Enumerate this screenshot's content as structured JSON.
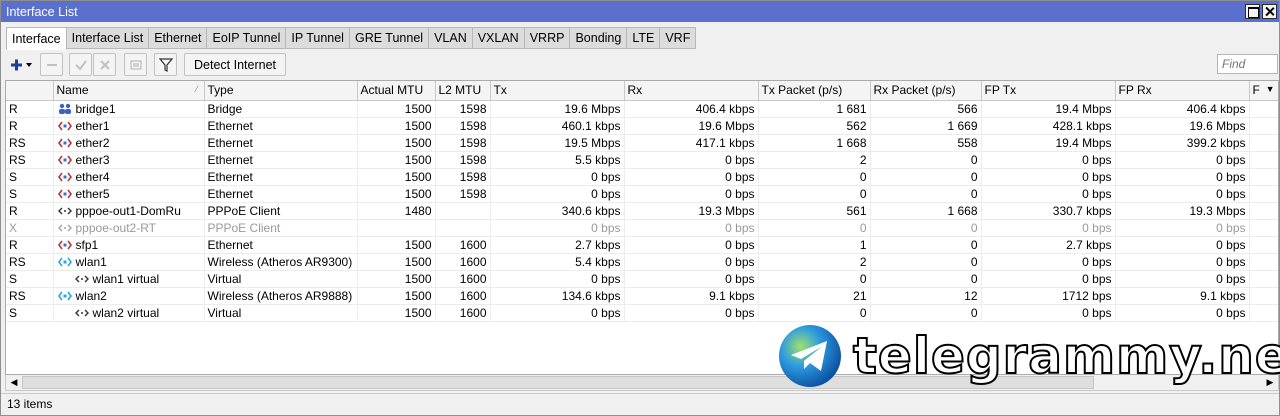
{
  "window": {
    "title": "Interface List"
  },
  "tabs": [
    {
      "label": "Interface",
      "active": true
    },
    {
      "label": "Interface List"
    },
    {
      "label": "Ethernet"
    },
    {
      "label": "EoIP Tunnel"
    },
    {
      "label": "IP Tunnel"
    },
    {
      "label": "GRE Tunnel"
    },
    {
      "label": "VLAN"
    },
    {
      "label": "VXLAN"
    },
    {
      "label": "VRRP"
    },
    {
      "label": "Bonding"
    },
    {
      "label": "LTE"
    },
    {
      "label": "VRF"
    }
  ],
  "toolbar": {
    "add_icon": "plus-icon",
    "remove_icon": "minus-icon",
    "enable_icon": "check-icon",
    "disable_icon": "cross-icon",
    "comment_icon": "comment-icon",
    "filter_icon": "filter-icon",
    "detect_label": "Detect Internet",
    "find_placeholder": "Find"
  },
  "table": {
    "columns": [
      "",
      "Name",
      "Type",
      "Actual MTU",
      "L2 MTU",
      "Tx",
      "Rx",
      "Tx Packet (p/s)",
      "Rx Packet (p/s)",
      "FP Tx",
      "FP Rx",
      "F"
    ],
    "rows": [
      {
        "flags": "R",
        "icon": "bridge-icon",
        "name": "bridge1",
        "indent": false,
        "type": "Bridge",
        "mtu": "1500",
        "l2mtu": "1598",
        "tx": "19.6 Mbps",
        "rx": "406.4 kbps",
        "txp": "1 681",
        "rxp": "566",
        "fptx": "19.4 Mbps",
        "fprx": "406.4 kbps",
        "disabled": false
      },
      {
        "flags": "R",
        "icon": "ethernet-icon",
        "name": "ether1",
        "indent": false,
        "type": "Ethernet",
        "mtu": "1500",
        "l2mtu": "1598",
        "tx": "460.1 kbps",
        "rx": "19.6 Mbps",
        "txp": "562",
        "rxp": "1 669",
        "fptx": "428.1 kbps",
        "fprx": "19.6 Mbps",
        "disabled": false
      },
      {
        "flags": "RS",
        "icon": "ethernet-icon",
        "name": "ether2",
        "indent": false,
        "type": "Ethernet",
        "mtu": "1500",
        "l2mtu": "1598",
        "tx": "19.5 Mbps",
        "rx": "417.1 kbps",
        "txp": "1 668",
        "rxp": "558",
        "fptx": "19.4 Mbps",
        "fprx": "399.2 kbps",
        "disabled": false
      },
      {
        "flags": "RS",
        "icon": "ethernet-icon",
        "name": "ether3",
        "indent": false,
        "type": "Ethernet",
        "mtu": "1500",
        "l2mtu": "1598",
        "tx": "5.5 kbps",
        "rx": "0 bps",
        "txp": "2",
        "rxp": "0",
        "fptx": "0 bps",
        "fprx": "0 bps",
        "disabled": false
      },
      {
        "flags": "S",
        "icon": "ethernet-icon",
        "name": "ether4",
        "indent": false,
        "type": "Ethernet",
        "mtu": "1500",
        "l2mtu": "1598",
        "tx": "0 bps",
        "rx": "0 bps",
        "txp": "0",
        "rxp": "0",
        "fptx": "0 bps",
        "fprx": "0 bps",
        "disabled": false
      },
      {
        "flags": "S",
        "icon": "ethernet-icon",
        "name": "ether5",
        "indent": false,
        "type": "Ethernet",
        "mtu": "1500",
        "l2mtu": "1598",
        "tx": "0 bps",
        "rx": "0 bps",
        "txp": "0",
        "rxp": "0",
        "fptx": "0 bps",
        "fprx": "0 bps",
        "disabled": false
      },
      {
        "flags": "R",
        "icon": "tunnel-icon",
        "name": "pppoe-out1-DomRu",
        "indent": false,
        "type": "PPPoE Client",
        "mtu": "1480",
        "l2mtu": "",
        "tx": "340.6 kbps",
        "rx": "19.3 Mbps",
        "txp": "561",
        "rxp": "1 668",
        "fptx": "330.7 kbps",
        "fprx": "19.3 Mbps",
        "disabled": false
      },
      {
        "flags": "X",
        "icon": "tunnel-icon",
        "name": "pppoe-out2-RT",
        "indent": false,
        "type": "PPPoE Client",
        "mtu": "",
        "l2mtu": "",
        "tx": "0 bps",
        "rx": "0 bps",
        "txp": "0",
        "rxp": "0",
        "fptx": "0 bps",
        "fprx": "0 bps",
        "disabled": true
      },
      {
        "flags": "R",
        "icon": "ethernet-icon",
        "name": "sfp1",
        "indent": false,
        "type": "Ethernet",
        "mtu": "1500",
        "l2mtu": "1600",
        "tx": "2.7 kbps",
        "rx": "0 bps",
        "txp": "1",
        "rxp": "0",
        "fptx": "2.7 kbps",
        "fprx": "0 bps",
        "disabled": false
      },
      {
        "flags": "RS",
        "icon": "wireless-icon",
        "name": "wlan1",
        "indent": false,
        "type": "Wireless (Atheros AR9300)",
        "mtu": "1500",
        "l2mtu": "1600",
        "tx": "5.4 kbps",
        "rx": "0 bps",
        "txp": "2",
        "rxp": "0",
        "fptx": "0 bps",
        "fprx": "0 bps",
        "disabled": false
      },
      {
        "flags": "S",
        "icon": "tunnel-icon",
        "name": "wlan1 virtual",
        "indent": true,
        "type": "Virtual",
        "mtu": "1500",
        "l2mtu": "1600",
        "tx": "0 bps",
        "rx": "0 bps",
        "txp": "0",
        "rxp": "0",
        "fptx": "0 bps",
        "fprx": "0 bps",
        "disabled": false
      },
      {
        "flags": "RS",
        "icon": "wireless-icon",
        "name": "wlan2",
        "indent": false,
        "type": "Wireless (Atheros AR9888)",
        "mtu": "1500",
        "l2mtu": "1600",
        "tx": "134.6 kbps",
        "rx": "9.1 kbps",
        "txp": "21",
        "rxp": "12",
        "fptx": "1712 bps",
        "fprx": "9.1 kbps",
        "disabled": false
      },
      {
        "flags": "S",
        "icon": "tunnel-icon",
        "name": "wlan2 virtual",
        "indent": true,
        "type": "Virtual",
        "mtu": "1500",
        "l2mtu": "1600",
        "tx": "0 bps",
        "rx": "0 bps",
        "txp": "0",
        "rxp": "0",
        "fptx": "0 bps",
        "fprx": "0 bps",
        "disabled": false
      }
    ]
  },
  "status": {
    "items_count": "13 items"
  },
  "watermark": {
    "text": "telegrammy.net",
    "logo": "telegram-logo"
  },
  "colors": {
    "titlebar": "#5b6fcd",
    "add_icon": "#1a3f9e"
  }
}
